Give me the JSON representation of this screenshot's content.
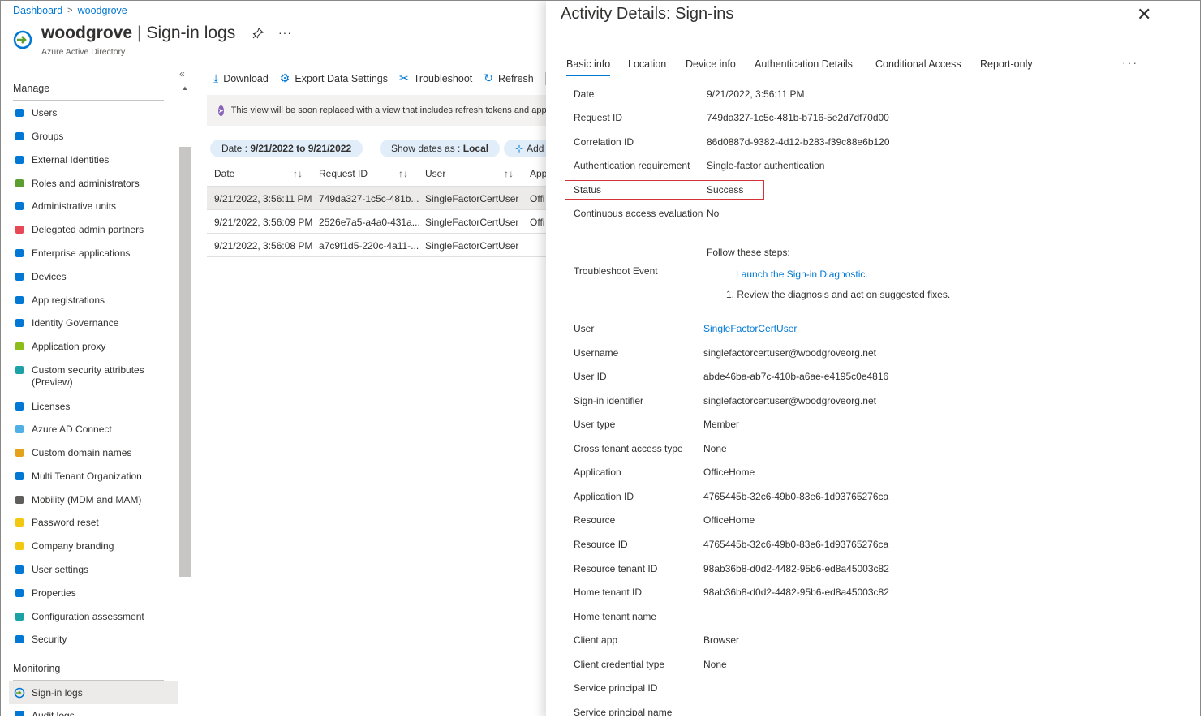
{
  "breadcrumb": [
    "Dashboard",
    "woodgrove"
  ],
  "header": {
    "title_org": "woodgrove",
    "title_sep": "|",
    "title_page": "Sign-in logs",
    "subtitle": "Azure Active Directory",
    "pin_icon": "pin-icon",
    "more": "···"
  },
  "sidebar": {
    "collapse": "«",
    "manage_label": "Manage",
    "items": [
      {
        "label": "Users",
        "icon": "user-icon",
        "color": "#0078d4"
      },
      {
        "label": "Groups",
        "icon": "group-icon",
        "color": "#0078d4"
      },
      {
        "label": "External Identities",
        "icon": "external-identities-icon",
        "color": "#0078d4"
      },
      {
        "label": "Roles and administrators",
        "icon": "roles-icon",
        "color": "#5c9e2f"
      },
      {
        "label": "Administrative units",
        "icon": "admin-units-icon",
        "color": "#0078d4"
      },
      {
        "label": "Delegated admin partners",
        "icon": "partners-icon",
        "color": "#e74856"
      },
      {
        "label": "Enterprise applications",
        "icon": "enterprise-apps-icon",
        "color": "#0078d4"
      },
      {
        "label": "Devices",
        "icon": "devices-icon",
        "color": "#0078d4"
      },
      {
        "label": "App registrations",
        "icon": "app-registrations-icon",
        "color": "#0078d4"
      },
      {
        "label": "Identity Governance",
        "icon": "identity-governance-icon",
        "color": "#0078d4"
      },
      {
        "label": "Application proxy",
        "icon": "app-proxy-icon",
        "color": "#8cbd18"
      },
      {
        "label": "Custom security attributes",
        "label2": "(Preview)",
        "icon": "custom-security-icon",
        "color": "#1ba1a6"
      },
      {
        "label": "Licenses",
        "icon": "licenses-icon",
        "color": "#0078d4"
      },
      {
        "label": "Azure AD Connect",
        "icon": "ad-connect-icon",
        "color": "#50b0e6"
      },
      {
        "label": "Custom domain names",
        "icon": "domain-names-icon",
        "color": "#e3a21a"
      },
      {
        "label": "Multi Tenant Organization",
        "icon": "multi-tenant-icon",
        "color": "#0078d4"
      },
      {
        "label": "Mobility (MDM and MAM)",
        "icon": "mobility-icon",
        "color": "#605e5c"
      },
      {
        "label": "Password reset",
        "icon": "key-icon",
        "color": "#f2c811"
      },
      {
        "label": "Company branding",
        "icon": "branding-icon",
        "color": "#f2c811"
      },
      {
        "label": "User settings",
        "icon": "user-settings-icon",
        "color": "#0078d4"
      },
      {
        "label": "Properties",
        "icon": "properties-icon",
        "color": "#0078d4"
      },
      {
        "label": "Configuration assessment",
        "icon": "assessment-icon",
        "color": "#1ba1a6"
      },
      {
        "label": "Security",
        "icon": "shield-icon",
        "color": "#0078d4"
      }
    ],
    "monitoring_label": "Monitoring",
    "monitoring_items": [
      {
        "label": "Sign-in logs",
        "icon": "sign-in-logs-icon",
        "color": "#0078d4"
      },
      {
        "label": "Audit logs",
        "icon": "audit-logs-icon",
        "color": "#0078d4"
      }
    ]
  },
  "toolbar": {
    "download": "Download",
    "export": "Export Data Settings",
    "troubleshoot": "Troubleshoot",
    "refresh": "Refresh"
  },
  "banner": "This view will be soon replaced with a view that includes refresh tokens and appl",
  "filters": {
    "date_prefix": "Date : ",
    "date_value": "9/21/2022 to 9/21/2022",
    "show_dates_prefix": "Show dates as : ",
    "show_dates_value": "Local",
    "add": "Add"
  },
  "grid": {
    "columns": [
      "Date",
      "Request ID",
      "User",
      "App"
    ],
    "rows": [
      {
        "date": "9/21/2022, 3:56:11 PM",
        "request_id": "749da327-1c5c-481b...",
        "user": "SingleFactorCertUser",
        "app": "Offi"
      },
      {
        "date": "9/21/2022, 3:56:09 PM",
        "request_id": "2526e7a5-a4a0-431a...",
        "user": "SingleFactorCertUser",
        "app": "Offi"
      },
      {
        "date": "9/21/2022, 3:56:08 PM",
        "request_id": "a7c9f1d5-220c-4a11-...",
        "user": "SingleFactorCertUser",
        "app": ""
      }
    ]
  },
  "panel": {
    "title": "Activity Details: Sign-ins",
    "close": "✕",
    "tabs": [
      "Basic info",
      "Location",
      "Device info",
      "Authentication Details",
      "Conditional Access",
      "Report-only"
    ],
    "tab_more": "···",
    "details_top": [
      {
        "label": "Date",
        "value": "9/21/2022, 3:56:11 PM"
      },
      {
        "label": "Request ID",
        "value": "749da327-1c5c-481b-b716-5e2d7df70d00"
      },
      {
        "label": "Correlation ID",
        "value": "86d0887d-9382-4d12-b283-f39c88e6b120"
      },
      {
        "label": "Authentication requirement",
        "value": "Single-factor authentication"
      },
      {
        "label": "Status",
        "value": "Success"
      },
      {
        "label": "Continuous access evaluation",
        "value": "No"
      }
    ],
    "troubleshoot": {
      "label": "Troubleshoot Event",
      "follow": "Follow these steps:",
      "link": "Launch the Sign-in Diagnostic.",
      "step": "1. Review the diagnosis and act on suggested fixes."
    },
    "details_bottom": [
      {
        "label": "User",
        "value": "SingleFactorCertUser"
      },
      {
        "label": "Username",
        "value": "singlefactorcertuser@woodgroveorg.net"
      },
      {
        "label": "User ID",
        "value": "abde46ba-ab7c-410b-a6ae-e4195c0e4816"
      },
      {
        "label": "Sign-in identifier",
        "value": "singlefactorcertuser@woodgroveorg.net"
      },
      {
        "label": "User type",
        "value": "Member"
      },
      {
        "label": "Cross tenant access type",
        "value": "None"
      },
      {
        "label": "Application",
        "value": "OfficeHome"
      },
      {
        "label": "Application ID",
        "value": "4765445b-32c6-49b0-83e6-1d93765276ca"
      },
      {
        "label": "Resource",
        "value": "OfficeHome"
      },
      {
        "label": "Resource ID",
        "value": "4765445b-32c6-49b0-83e6-1d93765276ca"
      },
      {
        "label": "Resource tenant ID",
        "value": "98ab36b8-d0d2-4482-95b6-ed8a45003c82"
      },
      {
        "label": "Home tenant ID",
        "value": "98ab36b8-d0d2-4482-95b6-ed8a45003c82"
      },
      {
        "label": "Home tenant name",
        "value": ""
      },
      {
        "label": "Client app",
        "value": "Browser"
      },
      {
        "label": "Client credential type",
        "value": "None"
      },
      {
        "label": "Service principal ID",
        "value": ""
      },
      {
        "label": "Service principal name",
        "value": ""
      }
    ]
  }
}
